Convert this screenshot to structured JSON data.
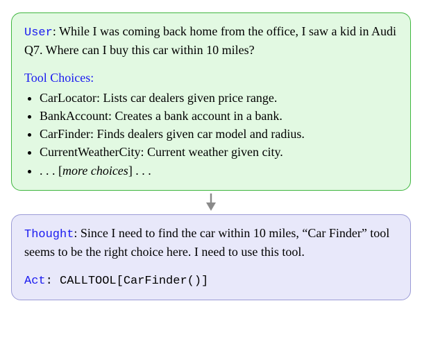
{
  "user_panel": {
    "label": "User",
    "query": ": While I was coming back home from the office, I saw a kid in Audi Q7.  Where can I buy this car within 10 miles?",
    "tool_choices_label": "Tool Choices:",
    "tools": [
      {
        "name": "CarLocator",
        "desc": ": Lists car dealers given price range."
      },
      {
        "name": "BankAccount",
        "desc": ": Creates a bank account in a bank."
      },
      {
        "name": "CarFinder",
        "desc": ": Finds dealers given car model and radius."
      },
      {
        "name": "CurrentWeatherCity",
        "desc": ": Current weather given city."
      }
    ],
    "more_prefix": ". . . [",
    "more_italic": "more choices",
    "more_suffix": "] . . ."
  },
  "thought_panel": {
    "thought_label": "Thought",
    "thought_text": ": Since I need to find the car within 10 miles, “Car Finder” tool seems to be the right choice here. I need to use this tool.",
    "act_label": "Act",
    "act_text": ": CALLTOOL[CarFinder()]"
  }
}
